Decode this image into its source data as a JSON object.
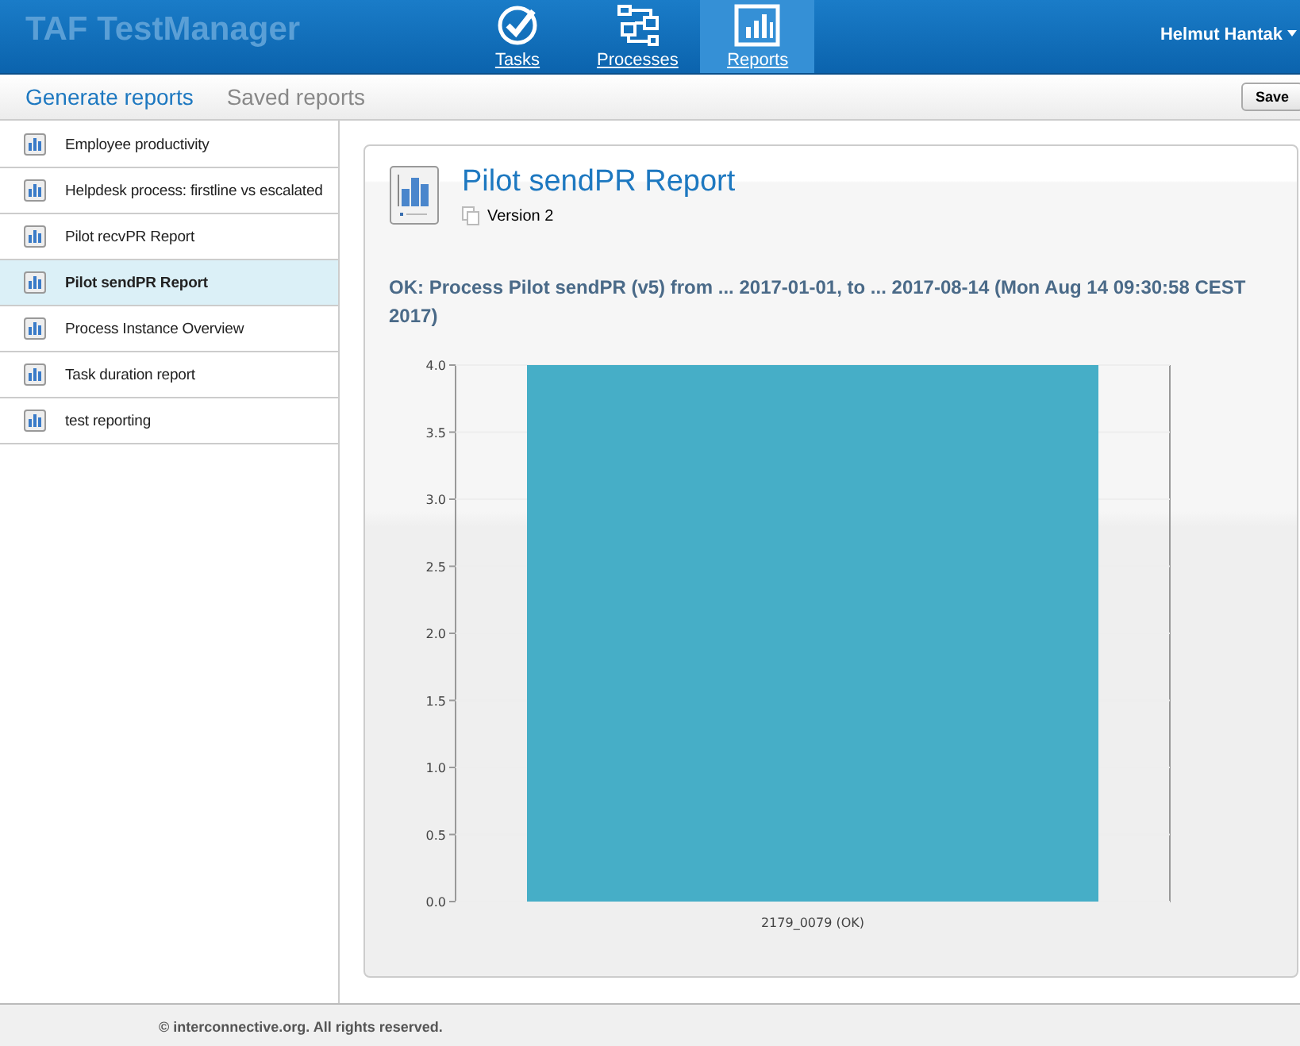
{
  "header": {
    "logo": "TAF TestManager",
    "nav": [
      {
        "label": "Tasks",
        "kind": "check",
        "selected": false
      },
      {
        "label": "Processes",
        "kind": "flow",
        "selected": false
      },
      {
        "label": "Reports",
        "kind": "chart",
        "selected": true
      }
    ],
    "user": "Helmut Hantak"
  },
  "subnav": {
    "tabs": [
      {
        "label": "Generate reports",
        "selected": true
      },
      {
        "label": "Saved reports",
        "selected": false
      }
    ],
    "save": "Save"
  },
  "sidebar": {
    "items": [
      {
        "label": "Employee productivity",
        "selected": false
      },
      {
        "label": "Helpdesk process: firstline vs escalated",
        "selected": false
      },
      {
        "label": "Pilot recvPR Report",
        "selected": false
      },
      {
        "label": "Pilot sendPR Report",
        "selected": true
      },
      {
        "label": "Process Instance Overview",
        "selected": false
      },
      {
        "label": "Task duration report",
        "selected": false
      },
      {
        "label": "test reporting",
        "selected": false
      }
    ]
  },
  "report": {
    "title": "Pilot sendPR Report",
    "version": "Version 2",
    "status": "OK: Process Pilot sendPR (v5) from ... 2017-01-01, to ... 2017-08-14 (Mon Aug 14 09:30:58 CEST 2017)",
    "chart_data": {
      "type": "bar",
      "categories": [
        "2179_0079 (OK)"
      ],
      "series": [
        {
          "color": "#46aec7",
          "values": [
            4
          ]
        }
      ],
      "grid": true,
      "ylim": [
        0,
        4
      ],
      "yticks": [
        {
          "value": 0,
          "label": "0.0"
        },
        {
          "value": 0.5,
          "label": "0.5"
        },
        {
          "value": 1,
          "label": "1.0"
        },
        {
          "value": 1.5,
          "label": "1.5"
        },
        {
          "value": 2,
          "label": "2.0"
        },
        {
          "value": 2.5,
          "label": "2.5"
        },
        {
          "value": 3,
          "label": "3.0"
        },
        {
          "value": 3.5,
          "label": "3.5"
        },
        {
          "value": 4,
          "label": "4.0"
        }
      ]
    }
  },
  "footer": "© interconnective.org. All rights reserved."
}
